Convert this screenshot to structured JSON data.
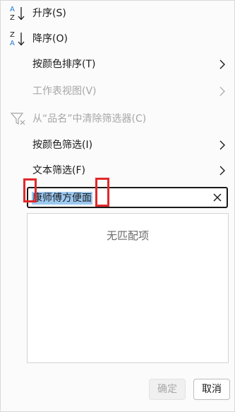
{
  "menu": {
    "sort_asc": {
      "label": "升序(S)",
      "icon": "sort-ascending-icon"
    },
    "sort_desc": {
      "label": "降序(O)",
      "icon": "sort-descending-icon"
    },
    "sort_by_color": {
      "label": "按颜色排序(T)"
    },
    "sheet_view": {
      "label": "工作表视图(V)"
    },
    "clear_filter": {
      "label": "从“品名”中清除筛选器(C)",
      "icon": "clear-filter-icon"
    },
    "filter_by_color": {
      "label": "按颜色筛选(I)"
    },
    "text_filter": {
      "label": "文本筛选(F)"
    }
  },
  "search": {
    "value": "康师傅方便面"
  },
  "list": {
    "empty_text": "无匹配项"
  },
  "buttons": {
    "ok": "确定",
    "cancel": "取消"
  },
  "colors": {
    "highlight_box": "#e0292b",
    "selection": "#9cc9f2",
    "sort_icon_blue": "#1f7ad1"
  }
}
